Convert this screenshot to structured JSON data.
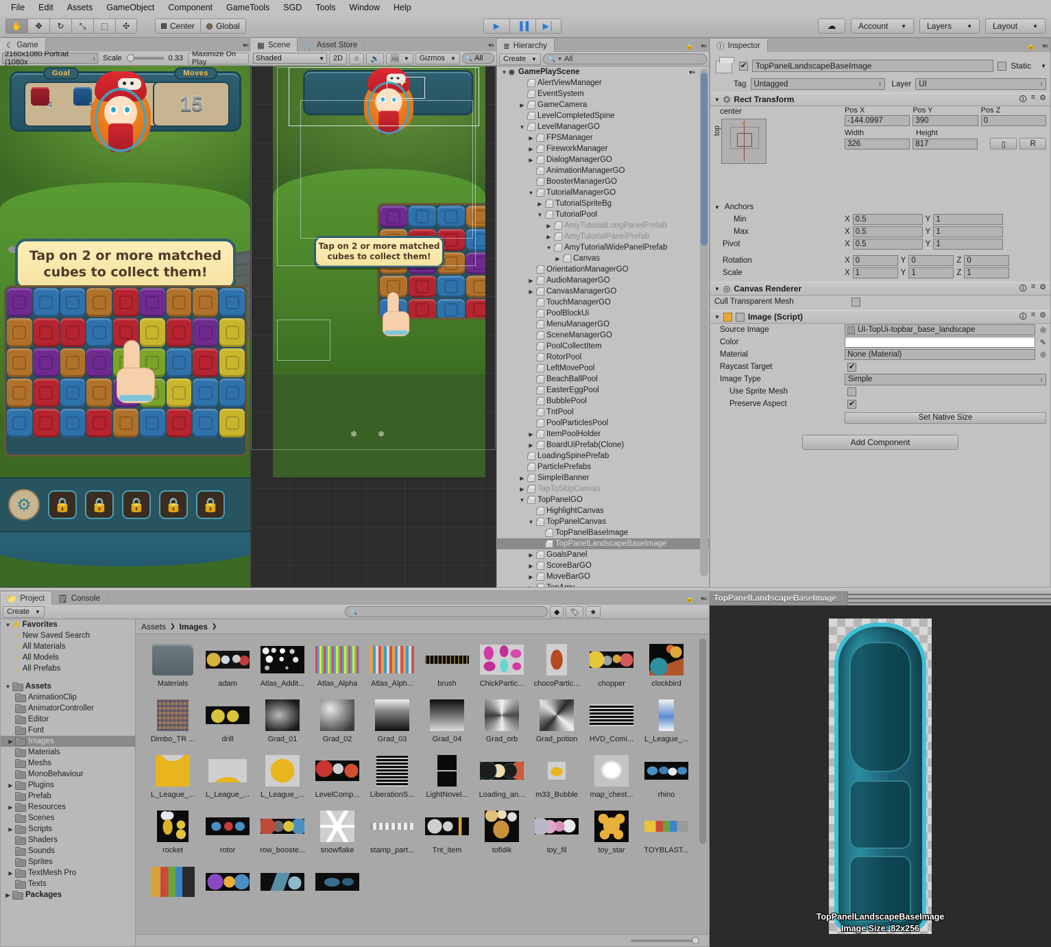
{
  "menubar": {
    "items": [
      "File",
      "Edit",
      "Assets",
      "GameObject",
      "Component",
      "GameTools",
      "SGD",
      "Tools",
      "Window",
      "Help"
    ]
  },
  "toolbar": {
    "transform_tools": [
      {
        "name": "hand-tool",
        "glyph": "✋"
      },
      {
        "name": "move-tool",
        "glyph": "✥"
      },
      {
        "name": "rotate-tool",
        "glyph": "↻"
      },
      {
        "name": "scale-tool",
        "glyph": "⤡"
      },
      {
        "name": "rect-tool",
        "glyph": "⬚"
      },
      {
        "name": "transform-tool",
        "glyph": "✣"
      }
    ],
    "pivot_label": "Center",
    "space_label": "Global",
    "play_label": "▶",
    "pause_label": "▐▐",
    "step_label": "▶│",
    "cloud_label": "☁",
    "account_label": "Account",
    "layers_label": "Layers",
    "layout_label": "Layout"
  },
  "game_view": {
    "tab_label": "Game",
    "resolution": "2160x1080 Portrait (1080x",
    "scale_label": "Scale",
    "scale_value": "0.33",
    "maximize_label": "Maximize On Play",
    "hud": {
      "goal_label": "Goal",
      "moves_label": "Moves",
      "goal_red_count": "4",
      "goal_blue_count": "10",
      "moves_value": "15"
    },
    "tutorial_text": "Tap on 2 or more matched cubes to collect them!",
    "board_rows": [
      [
        "c-pur",
        "c-blue",
        "c-blue",
        "c-org",
        "c-red",
        "c-pur",
        "c-org",
        "c-org",
        "c-blue"
      ],
      [
        "c-org",
        "c-red",
        "c-red",
        "c-blue",
        "c-red",
        "c-yel",
        "c-red",
        "c-pur",
        "c-yel"
      ],
      [
        "c-org",
        "c-pur",
        "c-org",
        "c-pur",
        "c-grn",
        "c-grn",
        "c-blue",
        "c-red",
        "c-yel"
      ],
      [
        "c-org",
        "c-red",
        "c-blue",
        "c-org",
        "c-pur",
        "c-grn",
        "c-yel",
        "c-blue",
        "c-blue"
      ],
      [
        "c-blue",
        "c-red",
        "c-blue",
        "c-red",
        "c-org",
        "c-blue",
        "c-red",
        "c-blue",
        "c-yel"
      ]
    ],
    "booster_slots": [
      "gear",
      "lock",
      "lock",
      "lock",
      "lock",
      "lock"
    ]
  },
  "scene_view": {
    "tabs": [
      {
        "label": "Scene",
        "icon": "grid-icon",
        "active": true
      },
      {
        "label": "Asset Store",
        "icon": "store-icon",
        "active": false
      }
    ],
    "shading_mode": "Shaded",
    "mode_2d": "2D",
    "lighting_icon": "sun-icon",
    "audio_icon": "speaker-icon",
    "effects_icon": "image-icon",
    "gizmos_label": "Gizmos",
    "search_placeholder": "All"
  },
  "hierarchy": {
    "tab_label": "Hierarchy",
    "create_label": "Create",
    "search_value": "All",
    "scene_root": "GamePlayScene",
    "items": [
      {
        "label": "AlertViewManager",
        "depth": 2,
        "arrow": "",
        "dim": false
      },
      {
        "label": "EventSystem",
        "depth": 2,
        "arrow": "",
        "dim": false
      },
      {
        "label": "GameCamera",
        "depth": 2,
        "arrow": "▶",
        "dim": false
      },
      {
        "label": "LevelCompletedSpine",
        "depth": 2,
        "arrow": "",
        "dim": false
      },
      {
        "label": "LevelManagerGO",
        "depth": 2,
        "arrow": "▼",
        "dim": false
      },
      {
        "label": "FPSManager",
        "depth": 3,
        "arrow": "▶",
        "dim": false
      },
      {
        "label": "FireworkManager",
        "depth": 3,
        "arrow": "▶",
        "dim": false
      },
      {
        "label": "DialogManagerGO",
        "depth": 3,
        "arrow": "▶",
        "dim": false
      },
      {
        "label": "AnimationManagerGO",
        "depth": 3,
        "arrow": "",
        "dim": false
      },
      {
        "label": "BoosterManagerGO",
        "depth": 3,
        "arrow": "",
        "dim": false
      },
      {
        "label": "TutorialManagerGO",
        "depth": 3,
        "arrow": "▼",
        "dim": false
      },
      {
        "label": "TutorialSpriteBg",
        "depth": 4,
        "arrow": "▶",
        "dim": false
      },
      {
        "label": "TutorialPool",
        "depth": 4,
        "arrow": "▼",
        "dim": false
      },
      {
        "label": "AmyTutorialLongPanelPrefab",
        "depth": 5,
        "arrow": "▶",
        "dim": true
      },
      {
        "label": "AmyTutorialPanelPrefab",
        "depth": 5,
        "arrow": "▶",
        "dim": true
      },
      {
        "label": "AmyTutorialWidePanelPrefab",
        "depth": 5,
        "arrow": "▼",
        "dim": false
      },
      {
        "label": "Canvas",
        "depth": 6,
        "arrow": "▶",
        "dim": false
      },
      {
        "label": "OrientationManagerGO",
        "depth": 3,
        "arrow": "",
        "dim": false
      },
      {
        "label": "AudioManagerGO",
        "depth": 3,
        "arrow": "▶",
        "dim": false
      },
      {
        "label": "CanvasManagerGO",
        "depth": 3,
        "arrow": "▶",
        "dim": false
      },
      {
        "label": "TouchManagerGO",
        "depth": 3,
        "arrow": "",
        "dim": false
      },
      {
        "label": "PoolBlockUi",
        "depth": 3,
        "arrow": "",
        "dim": false
      },
      {
        "label": "MenuManagerGO",
        "depth": 3,
        "arrow": "",
        "dim": false
      },
      {
        "label": "SceneManagerGO",
        "depth": 3,
        "arrow": "",
        "dim": false
      },
      {
        "label": "PoolCollectItem",
        "depth": 3,
        "arrow": "",
        "dim": false
      },
      {
        "label": "RotorPool",
        "depth": 3,
        "arrow": "",
        "dim": false
      },
      {
        "label": "LeftMovePool",
        "depth": 3,
        "arrow": "",
        "dim": false
      },
      {
        "label": "BeachBallPool",
        "depth": 3,
        "arrow": "",
        "dim": false
      },
      {
        "label": "EasterEggPool",
        "depth": 3,
        "arrow": "",
        "dim": false
      },
      {
        "label": "BubblePool",
        "depth": 3,
        "arrow": "",
        "dim": false
      },
      {
        "label": "TntPool",
        "depth": 3,
        "arrow": "",
        "dim": false
      },
      {
        "label": "PoolParticlesPool",
        "depth": 3,
        "arrow": "",
        "dim": false
      },
      {
        "label": "ItemPoolHolder",
        "depth": 3,
        "arrow": "▶",
        "dim": false
      },
      {
        "label": "BoardUiPrefab(Clone)",
        "depth": 3,
        "arrow": "▶",
        "dim": false
      },
      {
        "label": "LoadingSpinePrefab",
        "depth": 2,
        "arrow": "",
        "dim": false
      },
      {
        "label": "ParticlePrefabs",
        "depth": 2,
        "arrow": "",
        "dim": false
      },
      {
        "label": "SimpleIBanner",
        "depth": 2,
        "arrow": "▶",
        "dim": false
      },
      {
        "label": "TapToSkipCanvas",
        "depth": 2,
        "arrow": "▶",
        "dim": true
      },
      {
        "label": "TopPanelGO",
        "depth": 2,
        "arrow": "▼",
        "dim": false
      },
      {
        "label": "HighlightCanvas",
        "depth": 3,
        "arrow": "",
        "dim": false
      },
      {
        "label": "TopPanelCanvas",
        "depth": 3,
        "arrow": "▼",
        "dim": false
      },
      {
        "label": "TopPanelBaseImage",
        "depth": 4,
        "arrow": "",
        "dim": false
      },
      {
        "label": "TopPanelLandscapeBaseImage",
        "depth": 4,
        "arrow": "",
        "dim": true,
        "selected": true
      },
      {
        "label": "GoalsPanel",
        "depth": 3,
        "arrow": "▶",
        "dim": false
      },
      {
        "label": "ScoreBarGO",
        "depth": 3,
        "arrow": "▶",
        "dim": false
      },
      {
        "label": "MoveBarGO",
        "depth": 3,
        "arrow": "▶",
        "dim": false
      },
      {
        "label": "TopAmy",
        "depth": 3,
        "arrow": "▶",
        "dim": false
      }
    ]
  },
  "inspector": {
    "tab_label": "Inspector",
    "object_name": "TopPanelLandscapeBaseImage",
    "enabled": true,
    "static_label": "Static",
    "tag_label": "Tag",
    "tag_value": "Untagged",
    "layer_label": "Layer",
    "layer_value": "UI",
    "rect_transform": {
      "title": "Rect Transform",
      "anchor_preset": "center",
      "anchor_preset_side": "top",
      "pos_x_label": "Pos X",
      "pos_x": "-144.0997",
      "pos_y_label": "Pos Y",
      "pos_y": "390",
      "pos_z_label": "Pos Z",
      "pos_z": "0",
      "width_label": "Width",
      "width": "326",
      "height_label": "Height",
      "height": "817",
      "blueprint_label": "R",
      "anchors_label": "Anchors",
      "min_label": "Min",
      "min_x": "0.5",
      "min_y": "1",
      "max_label": "Max",
      "max_x": "0.5",
      "max_y": "1",
      "pivot_label": "Pivot",
      "pivot_x": "0.5",
      "pivot_y": "1",
      "rotation_label": "Rotation",
      "rot_x": "0",
      "rot_y": "0",
      "rot_z": "0",
      "scale_label": "Scale",
      "scale_x": "1",
      "scale_y": "1",
      "scale_z": "1"
    },
    "canvas_renderer": {
      "title": "Canvas Renderer",
      "cull_label": "Cull Transparent Mesh",
      "cull_checked": false
    },
    "image_script": {
      "title": "Image (Script)",
      "enabled": false,
      "source_image_label": "Source Image",
      "source_image_value": "UI-TopUi-topbar_base_landscape",
      "color_label": "Color",
      "color_value": "#FFFFFF",
      "material_label": "Material",
      "material_value": "None (Material)",
      "raycast_label": "Raycast Target",
      "raycast_checked": true,
      "image_type_label": "Image Type",
      "image_type_value": "Simple",
      "use_sprite_mesh_label": "Use Sprite Mesh",
      "use_sprite_mesh_checked": false,
      "preserve_aspect_label": "Preserve Aspect",
      "preserve_aspect_checked": true,
      "set_native_size_label": "Set Native Size"
    },
    "add_component_label": "Add Component"
  },
  "project": {
    "tabs": [
      {
        "label": "Project",
        "icon": "folder-icon",
        "active": true
      },
      {
        "label": "Console",
        "icon": "console-icon",
        "active": false
      }
    ],
    "create_label": "Create",
    "search_placeholder": "",
    "favorites_label": "Favorites",
    "favorites": [
      "New Saved Search",
      "All Materials",
      "All Models",
      "All Prefabs"
    ],
    "assets_label": "Assets",
    "folders": [
      {
        "label": "AnimationClip",
        "arrow": ""
      },
      {
        "label": "AnimatorController",
        "arrow": ""
      },
      {
        "label": "Editor",
        "arrow": ""
      },
      {
        "label": "Font",
        "arrow": ""
      },
      {
        "label": "Images",
        "arrow": "▶",
        "selected": true
      },
      {
        "label": "Materials",
        "arrow": ""
      },
      {
        "label": "Meshs",
        "arrow": ""
      },
      {
        "label": "MonoBehaviour",
        "arrow": ""
      },
      {
        "label": "Plugins",
        "arrow": "▶"
      },
      {
        "label": "Prefab",
        "arrow": ""
      },
      {
        "label": "Resources",
        "arrow": "▶"
      },
      {
        "label": "Scenes",
        "arrow": ""
      },
      {
        "label": "Scripts",
        "arrow": "▶"
      },
      {
        "label": "Shaders",
        "arrow": ""
      },
      {
        "label": "Sounds",
        "arrow": ""
      },
      {
        "label": "Sprites",
        "arrow": ""
      },
      {
        "label": "TextMesh Pro",
        "arrow": "▶"
      },
      {
        "label": "Texts",
        "arrow": ""
      }
    ],
    "packages_label": "Packages",
    "breadcrumb": [
      "Assets",
      "Images"
    ],
    "assets_grid": [
      {
        "label": "Materials",
        "kind": "folder"
      },
      {
        "label": "adam",
        "kind": "atlas-dark"
      },
      {
        "label": "Atlas_Addit...",
        "kind": "atlas-shapes"
      },
      {
        "label": "Atlas_Alpha",
        "kind": "atlas-color"
      },
      {
        "label": "Atlas_Alph...",
        "kind": "atlas-color2"
      },
      {
        "label": "brush",
        "kind": "strip-dark"
      },
      {
        "label": "ChickPartic...",
        "kind": "pink-particles"
      },
      {
        "label": "chocoPartic...",
        "kind": "choco"
      },
      {
        "label": "chopper",
        "kind": "atlas-dark2"
      },
      {
        "label": "clockbird",
        "kind": "clockbird"
      },
      {
        "label": "Dimbo_TR ...",
        "kind": "font-atlas"
      },
      {
        "label": "drill",
        "kind": "drill"
      },
      {
        "label": "Grad_01",
        "kind": "grad1"
      },
      {
        "label": "Grad_02",
        "kind": "grad2"
      },
      {
        "label": "Grad_03",
        "kind": "grad3"
      },
      {
        "label": "Grad_04",
        "kind": "grad4"
      },
      {
        "label": "Grad_orb",
        "kind": "grad-orb"
      },
      {
        "label": "Grad_potion",
        "kind": "grad-potion"
      },
      {
        "label": "HVD_Comi...",
        "kind": "font-atlas-dark"
      },
      {
        "label": "L_League_...",
        "kind": "league-bar"
      },
      {
        "label": "L_League_...",
        "kind": "league-v"
      },
      {
        "label": "L_League_...",
        "kind": "league-curve"
      },
      {
        "label": "L_League_...",
        "kind": "league-circle"
      },
      {
        "label": "LevelComp...",
        "kind": "levelcomplete"
      },
      {
        "label": "LiberationS...",
        "kind": "font-atlas2"
      },
      {
        "label": "LightNovel...",
        "kind": "font-tall"
      },
      {
        "label": "Loading_an...",
        "kind": "loading"
      },
      {
        "label": "m33_Bubble",
        "kind": "bubble"
      },
      {
        "label": "map_chest...",
        "kind": "white-blob"
      },
      {
        "label": "rhino",
        "kind": "rhino"
      },
      {
        "label": "rocket",
        "kind": "rocket"
      },
      {
        "label": "rotor",
        "kind": "rotor"
      },
      {
        "label": "row_booste...",
        "kind": "row-booster"
      },
      {
        "label": "snowflake",
        "kind": "snowflake"
      },
      {
        "label": "stamp_part...",
        "kind": "stamp"
      },
      {
        "label": "Tnt_item",
        "kind": "tnt"
      },
      {
        "label": "tofidik",
        "kind": "tofidik"
      },
      {
        "label": "toy_fil",
        "kind": "toyfil"
      },
      {
        "label": "toy_star",
        "kind": "toystar"
      },
      {
        "label": "TOYBLAST...",
        "kind": "toyblast"
      },
      {
        "label": "",
        "kind": "sel-dark",
        "selected": true
      },
      {
        "label": "",
        "kind": "misc1"
      },
      {
        "label": "",
        "kind": "misc2"
      },
      {
        "label": "",
        "kind": "misc3"
      }
    ]
  },
  "preview": {
    "title": "TopPanelLandscapeBaseImage",
    "caption_name": "TopPanelLandscapeBaseImage",
    "caption_size": "Image Size: 82x256"
  }
}
